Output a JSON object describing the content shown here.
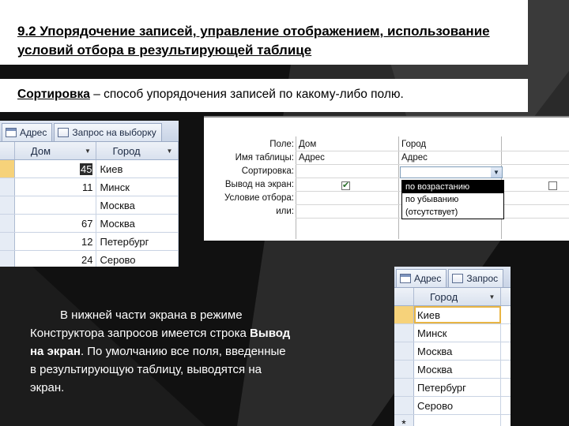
{
  "slide": {
    "title": "9.2 Упорядочение записей, управление отображением, использование условий отбора  в результирующей таблице ",
    "definition": {
      "term": "Сортировка",
      "text": " – способ упорядочения записей по какому-либо полю."
    },
    "paragraph": {
      "part1": "В нижней части экрана в режиме Конструктора запросов имеется строка ",
      "bold": "Вывод на экран",
      "part2": ". По умолчанию все поля, введенные в результирующую таблицу, выводятся на экран."
    }
  },
  "table_left": {
    "tabs": [
      "Адрес",
      "Запрос на выборку"
    ],
    "columns": [
      "Дом",
      "Город"
    ],
    "rows": [
      {
        "dom": "45",
        "gorod": "Киев"
      },
      {
        "dom": "11",
        "gorod": "Минск"
      },
      {
        "dom": "",
        "gorod": "Москва"
      },
      {
        "dom": "67",
        "gorod": "Москва"
      },
      {
        "dom": "12",
        "gorod": "Петербург"
      },
      {
        "dom": "24",
        "gorod": "Серово"
      }
    ]
  },
  "qbe_grid": {
    "row_labels": [
      "Поле:",
      "Имя таблицы:",
      "Сортировка:",
      "Вывод на экран:",
      "Условие отбора:",
      "или:"
    ],
    "col1": {
      "field": "Дом",
      "table": "Адрес",
      "show": true
    },
    "col2": {
      "field": "Город",
      "table": "Адрес"
    },
    "col3": {
      "show": false
    },
    "sort_options": [
      "по возрастанию",
      "по убыванию",
      "(отсутствует)"
    ],
    "sort_selected": "по возрастанию"
  },
  "table_right": {
    "tabs": [
      "Адрес",
      "Запрос"
    ],
    "column": "Город",
    "rows": [
      "Киев",
      "Минск",
      "Москва",
      "Москва",
      "Петербург",
      "Серово"
    ],
    "new_row_marker": "*"
  }
}
